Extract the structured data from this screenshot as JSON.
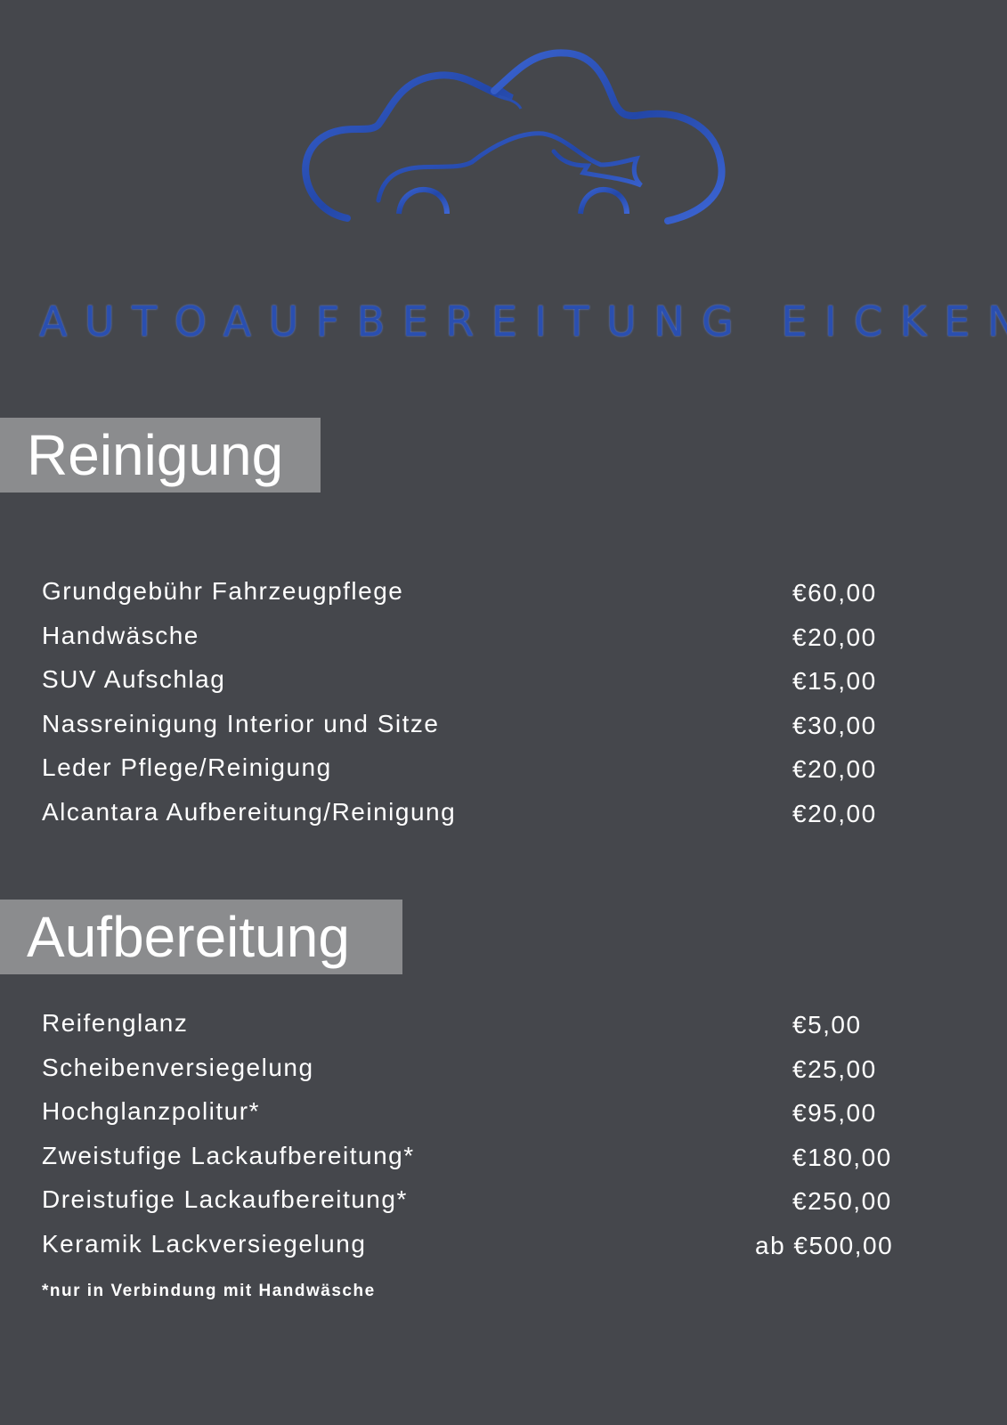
{
  "brand": {
    "name": "AUTOAUFBEREITUNG EICKEN",
    "logo_icon": "car-cloud-logo",
    "accent_color": "#2a4fb0"
  },
  "sections": [
    {
      "title": "Reinigung",
      "items": [
        {
          "name": "Grundgebühr Fahrzeugpflege",
          "price": "€60,00"
        },
        {
          "name": "Handwäsche",
          "price": "€20,00"
        },
        {
          "name": "SUV Aufschlag",
          "price": "€15,00"
        },
        {
          "name": "Nassreinigung Interior und Sitze",
          "price": "€30,00"
        },
        {
          "name": "Leder Pflege/Reinigung",
          "price": "€20,00"
        },
        {
          "name": "Alcantara Aufbereitung/Reinigung",
          "price": "€20,00"
        }
      ]
    },
    {
      "title": "Aufbereitung",
      "items": [
        {
          "name": "Reifenglanz",
          "price": "€5,00"
        },
        {
          "name": "Scheibenversiegelung",
          "price": "€25,00"
        },
        {
          "name": "Hochglanzpolitur*",
          "price": "€95,00"
        },
        {
          "name": "Zweistufige Lackaufbereitung*",
          "price": "€180,00"
        },
        {
          "name": "Dreistufige Lackaufbereitung*",
          "price": "€250,00"
        },
        {
          "name": "Keramik Lackversiegelung",
          "price": "ab €500,00"
        }
      ]
    }
  ],
  "footnote": "*nur in Verbindung mit Handwäsche"
}
